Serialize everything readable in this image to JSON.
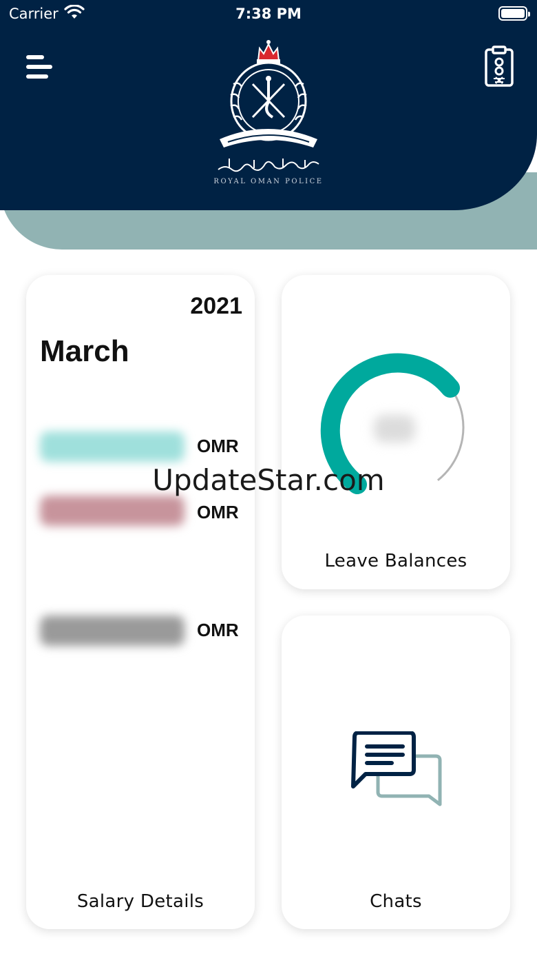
{
  "status_bar": {
    "carrier": "Carrier",
    "time": "7:38 PM"
  },
  "header": {
    "organization": "ROYAL OMAN POLICE",
    "menu_icon": "hamburger-menu-icon",
    "id_card_icon": "id-badge-icon",
    "colors": {
      "header_bg": "#002244",
      "band": "#91b3b3"
    }
  },
  "salary_card": {
    "year": "2021",
    "month": "March",
    "currency_rows": [
      "OMR",
      "OMR",
      "OMR"
    ],
    "label": "Salary Details"
  },
  "leave_card": {
    "label": "Leave Balances",
    "gauge_color": "#00a99d"
  },
  "chats_card": {
    "label": "Chats",
    "icon": "chat-bubbles-icon"
  },
  "watermark": "UpdateStar.com"
}
